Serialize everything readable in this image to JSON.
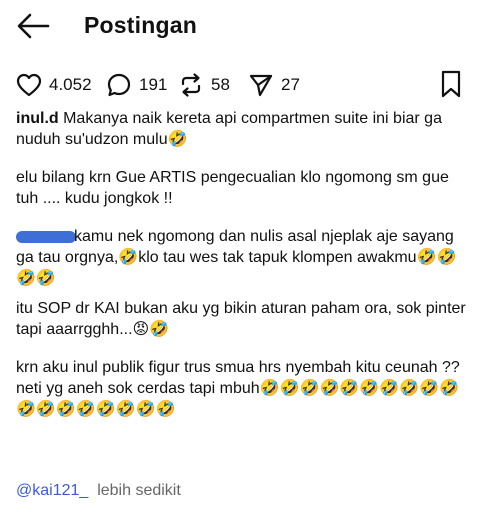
{
  "header": {
    "title": "Postingan"
  },
  "actions": {
    "likes": "4.052",
    "comments": "191",
    "reposts": "58",
    "shares": "27"
  },
  "post": {
    "username": "inul.d",
    "p1": " Makanya naik kereta api compartmen suite ini biar ga nuduh su'udzon mulu🤣",
    "p2": "elu bilang krn Gue ARTIS pengecualian klo ngomong sm gue tuh .... kudu jongkok !!",
    "p3": "kamu nek ngomong dan nulis asal njeplak aje sayang ga tau orgnya,🤣klo tau wes tak tapuk klompen awakmu🤣🤣🤣🤣",
    "p4": "itu SOP dr KAI bukan aku yg bikin aturan paham ora, sok pinter tapi aaarrgghh...😡🤣",
    "p5a": "krn aku inul publik figur trus smua hrs nyembah kitu ceunah ??",
    "p5b": "neti yg aneh sok cerdas tapi mbuh🤣🤣🤣🤣🤣🤣🤣🤣🤣🤣🤣🤣🤣🤣🤣🤣🤣🤣"
  },
  "footer": {
    "mention": "@kai121_",
    "more": "lebih sedikit"
  }
}
